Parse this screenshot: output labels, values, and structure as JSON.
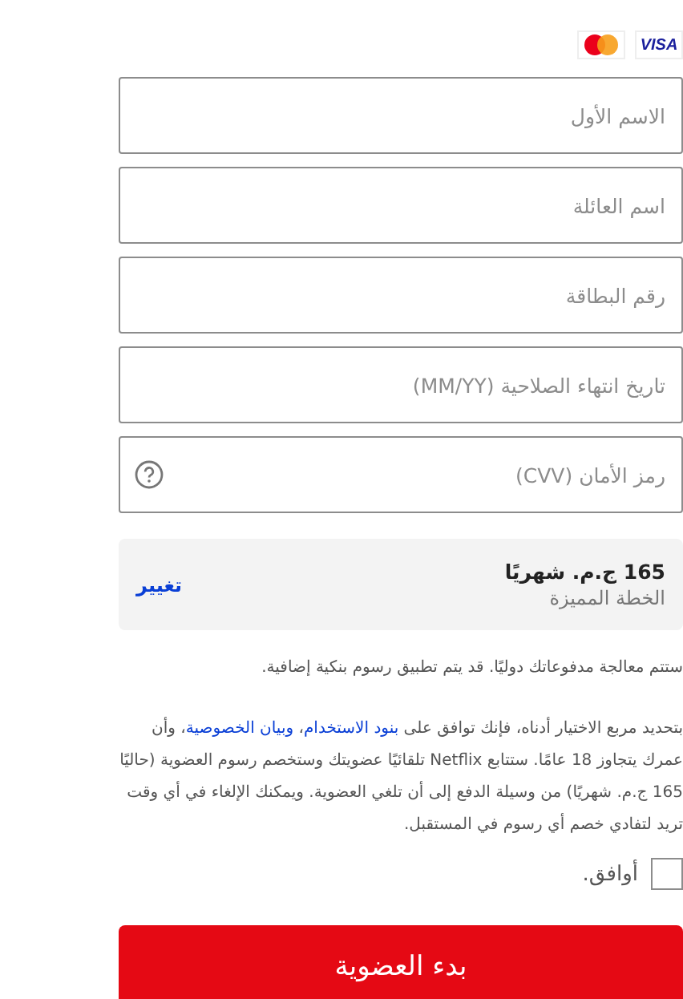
{
  "card_logos": [
    {
      "kind": "visa",
      "label": "VISA"
    },
    {
      "kind": "mastercard"
    }
  ],
  "fields": [
    {
      "placeholder": "الاسم الأول"
    },
    {
      "placeholder": "اسم العائلة"
    },
    {
      "placeholder": "رقم البطاقة"
    },
    {
      "placeholder": "تاريخ انتهاء الصلاحية (MM/YY)"
    },
    {
      "placeholder": "رمز الأمان (CVV)",
      "help_icon": true
    }
  ],
  "plan": {
    "price": "165 ج.م. شهريًا",
    "name": "الخطة المميزة",
    "change_link": "تغيير"
  },
  "notice": "ستتم معالجة مدفوعاتك دوليًا. قد يتم تطبيق رسوم بنكية إضافية.",
  "terms": [
    {
      "kind": "text",
      "text": "بتحديد مربع الاختيار أدناه، فإنك توافق على "
    },
    {
      "kind": "link",
      "text": "بنود الاستخدام"
    },
    {
      "kind": "text",
      "text": "، "
    },
    {
      "kind": "link",
      "text": "وبيان الخصوصية"
    },
    {
      "kind": "text",
      "text": "، وأن عمرك يتجاوز 18 عامًا. ستتابع Netflix تلقائيًا عضويتك وستخصم رسوم العضوية (حاليًا 165 ج.م. شهريًا) من وسيلة الدفع إلى أن تلغي العضوية. ويمكنك الإلغاء في أي وقت تريد لتفادي خصم أي رسوم في المستقبل."
    }
  ],
  "agree": {
    "label": "أوافق.",
    "checked": false
  },
  "submit_button": "بدء العضوية"
}
